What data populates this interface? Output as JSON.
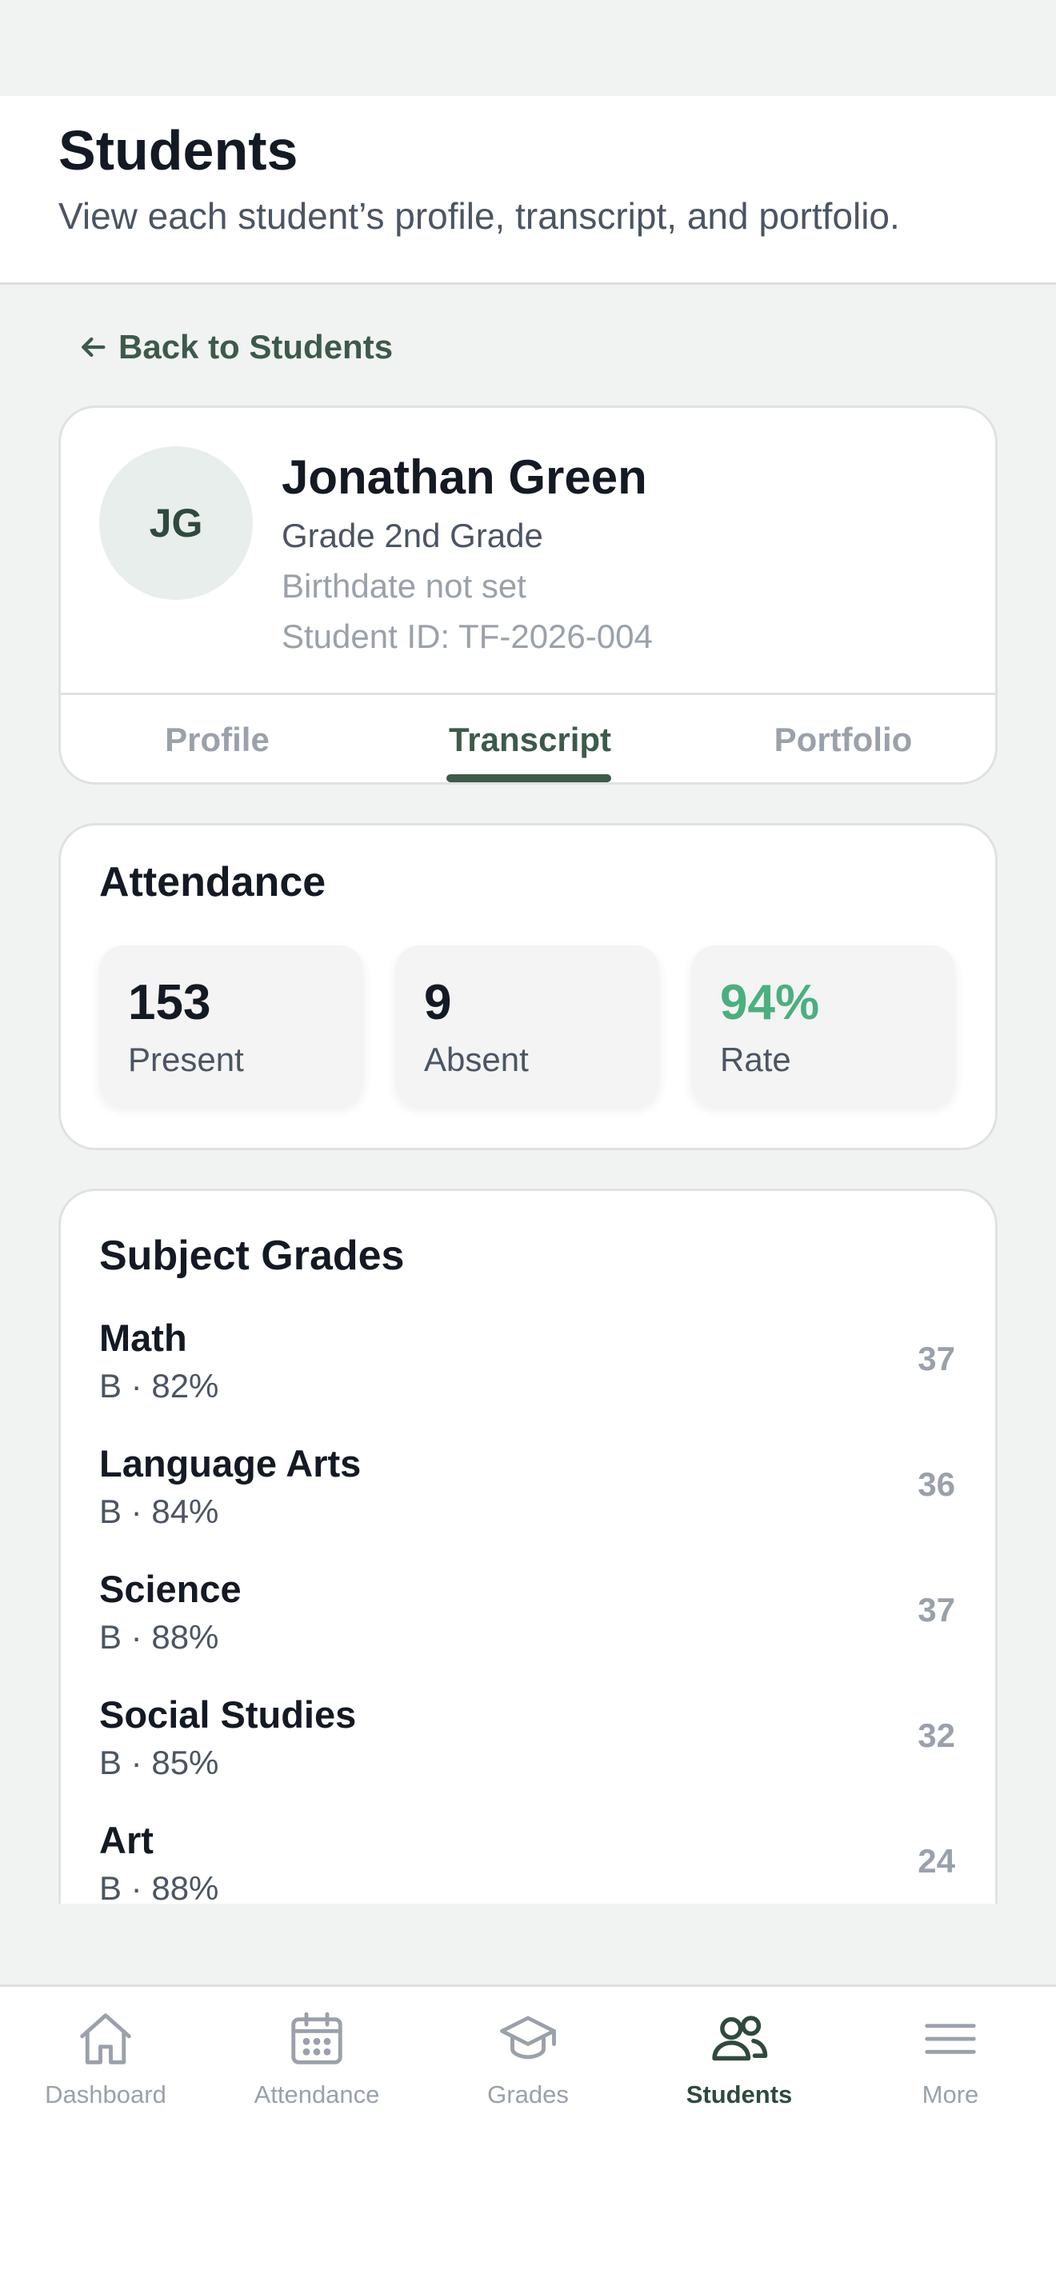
{
  "header": {
    "title": "Students",
    "subtitle": "View each student’s profile, transcript, and portfolio."
  },
  "back_link": {
    "label": "Back to Students"
  },
  "student": {
    "initials": "JG",
    "name": "Jonathan Green",
    "grade": "Grade 2nd Grade",
    "birthdate": "Birthdate not set",
    "student_id": "Student ID: TF-2026-004"
  },
  "tabs": [
    {
      "label": "Profile",
      "active": false
    },
    {
      "label": "Transcript",
      "active": true
    },
    {
      "label": "Portfolio",
      "active": false
    }
  ],
  "attendance": {
    "title": "Attendance",
    "stats": [
      {
        "value": "153",
        "label": "Present"
      },
      {
        "value": "9",
        "label": "Absent"
      },
      {
        "value": "94%",
        "label": "Rate"
      }
    ],
    "accent_color": "#4caf80"
  },
  "grades": {
    "title": "Subject Grades",
    "rows": [
      {
        "subject": "Math",
        "detail": "B · 82%",
        "count": "37"
      },
      {
        "subject": "Language Arts",
        "detail": "B · 84%",
        "count": "36"
      },
      {
        "subject": "Science",
        "detail": "B · 88%",
        "count": "37"
      },
      {
        "subject": "Social Studies",
        "detail": "B · 85%",
        "count": "32"
      },
      {
        "subject": "Art",
        "detail": "B · 88%",
        "count": "24"
      }
    ]
  },
  "bottom_nav": {
    "items": [
      {
        "label": "Dashboard",
        "icon": "home-icon",
        "active": false
      },
      {
        "label": "Attendance",
        "icon": "calendar-icon",
        "active": false
      },
      {
        "label": "Grades",
        "icon": "graduation-cap-icon",
        "active": false
      },
      {
        "label": "Students",
        "icon": "users-icon",
        "active": true
      },
      {
        "label": "More",
        "icon": "menu-icon",
        "active": false
      }
    ]
  },
  "colors": {
    "primary": "#3d5a4b",
    "background": "#f1f3f2",
    "muted": "#9aa1ab"
  }
}
